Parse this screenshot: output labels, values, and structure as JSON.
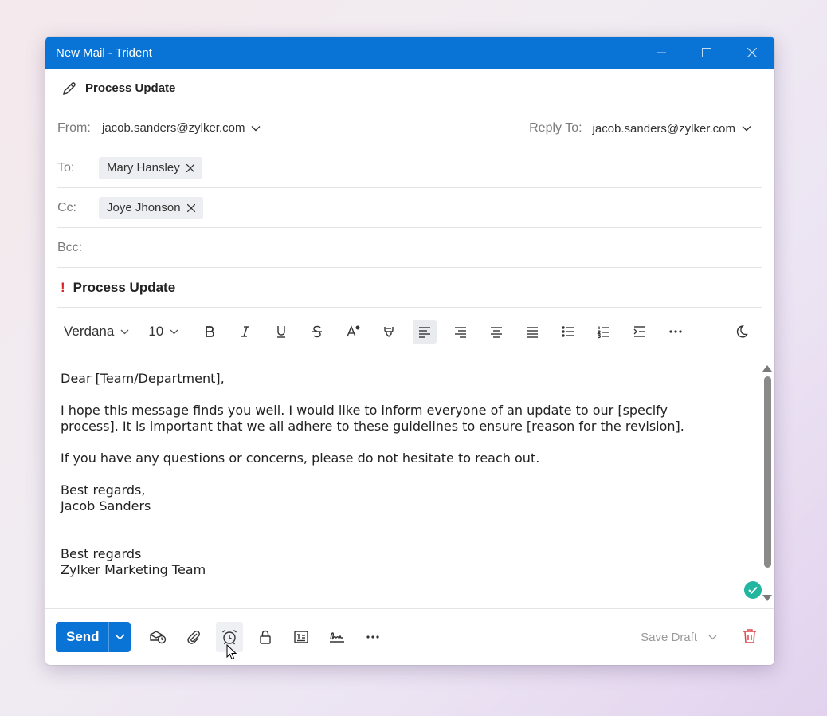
{
  "window": {
    "title": "New Mail - Trident"
  },
  "header": {
    "subject_title": "Process Update"
  },
  "from": {
    "label": "From:",
    "address": "jacob.sanders@zylker.com"
  },
  "reply_to": {
    "label": "Reply To:",
    "address": "jacob.sanders@zylker.com"
  },
  "to": {
    "label": "To:",
    "recipients": [
      "Mary Hansley"
    ]
  },
  "cc": {
    "label": "Cc:",
    "recipients": [
      "Joye Jhonson"
    ]
  },
  "bcc": {
    "label": "Bcc:"
  },
  "subject": {
    "importance_mark": "!",
    "text": "Process Update"
  },
  "format_toolbar": {
    "font_family": "Verdana",
    "font_size": "10",
    "active_alignment": "align-left"
  },
  "body": {
    "greeting": "Dear [Team/Department],",
    "para1_line1": "I hope this message finds you well. I would like to inform everyone of an update to our [specify",
    "para1_line2": "process]. It is important that we all adhere to these guidelines to ensure [reason for the revision].",
    "para2": "If you have any questions or concerns, please do not hesitate to reach out.",
    "closing1": "Best regards,",
    "name1": "Jacob Sanders",
    "closing2": "Best regards",
    "name2": "Zylker Marketing Team"
  },
  "footer": {
    "send_label": "Send",
    "save_draft_label": "Save Draft",
    "hovered_icon": "alarm-clock-icon"
  },
  "colors": {
    "accent": "#0a74d6",
    "importance": "#d9262b",
    "trash": "#e0474c",
    "grammar_ok": "#22b5a0"
  }
}
